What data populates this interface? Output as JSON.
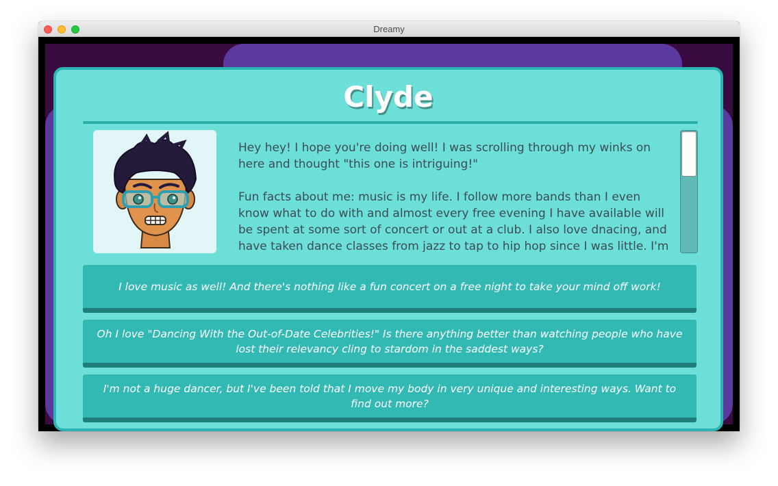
{
  "window": {
    "title": "Dreamy"
  },
  "profile": {
    "name": "Clyde",
    "avatar": "cartoon-man-glasses",
    "bio": [
      "Hey hey! I hope you're doing well! I was scrolling through my winks on here and thought \"this one is intriguing!\"",
      "Fun facts about me: music is my life. I follow more bands than I even know what to do with and almost every free evening I have available will be spent at some sort of concert or out at a club. I also love dnacing, and have taken dance classes from jazz to tap to hip hop since I was little. I'm also"
    ]
  },
  "replies": [
    "I love music as well! And there's nothing like a fun concert on a free night to take your mind off work!",
    "Oh I love \"Dancing With the Out-of-Date Celebrities!\" Is there anything better than watching people who have lost their relevancy cling to stardom in the saddest ways?",
    "I'm not a huge dancer, but I've been told that I move my body in very unique and interesting ways. Want to find out more?"
  ],
  "colors": {
    "panel": "#6ddfd9",
    "panel_border": "#2bb4b1",
    "button": "#33b9b4",
    "button_shadow": "#207f7c",
    "background": "#3a0b40",
    "background_blob": "#5b3aa0"
  }
}
